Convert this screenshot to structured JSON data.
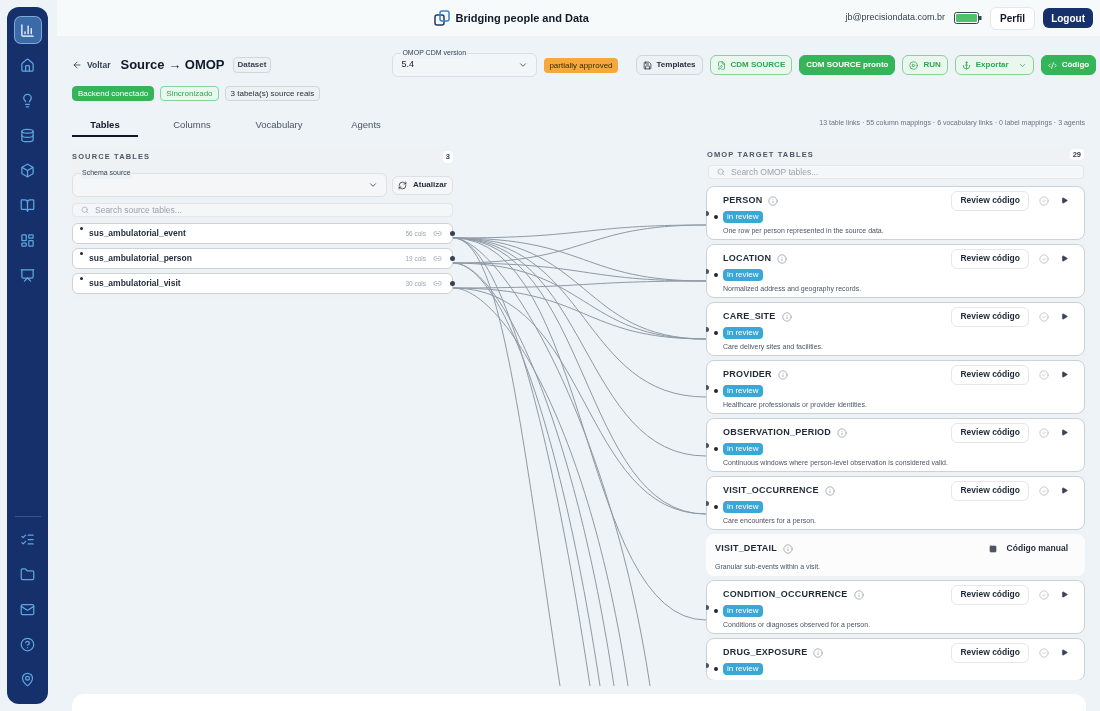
{
  "sidebar": {
    "items": [
      {
        "selected": true
      },
      {
        "selected": false
      },
      {
        "selected": false
      },
      {
        "selected": false
      },
      {
        "selected": false
      },
      {
        "selected": false
      },
      {
        "selected": false
      },
      {
        "selected": false
      }
    ],
    "bottom_items": [
      {
        "selected": false
      },
      {
        "selected": false
      },
      {
        "selected": false
      },
      {
        "selected": false
      },
      {
        "selected": false
      }
    ]
  },
  "header": {
    "brand": "Bridging people and Data",
    "email": "jb@precisiondata.com.br",
    "buttons": [
      "Perfil",
      "Logout"
    ]
  },
  "toolbar": {
    "back": "Voltar",
    "title": "Source → OMOP",
    "title_badge": "Dataset",
    "version": {
      "label": "OMOP CDM version",
      "value": "5.4"
    },
    "approval": "partially approved",
    "buttons": [
      {
        "kind": "neutral",
        "label": "Templates"
      },
      {
        "kind": "outline",
        "label": "CDM SOURCE"
      },
      {
        "kind": "solid",
        "label": "CDM SOURCE pronto"
      },
      {
        "kind": "outline",
        "label": "RUN"
      },
      {
        "kind": "dropdown",
        "label": "Exportar"
      },
      {
        "kind": "solid",
        "label": "Código"
      }
    ]
  },
  "status_badges": [
    {
      "kind": "solid",
      "label": "Backend conectado"
    },
    {
      "kind": "outline",
      "label": "Sincronizado"
    },
    {
      "kind": "neutral",
      "label": "3 tabela(s) source reais"
    }
  ],
  "tabs": [
    {
      "label": "Tables",
      "selected": true
    },
    {
      "label": "Columns",
      "selected": false
    },
    {
      "label": "Vocabulary",
      "selected": false
    },
    {
      "label": "Agents",
      "selected": false
    }
  ],
  "stats": "13 table links · 55 column mappings · 6 vocabulary links · 0 label mappings · 3 agents",
  "source_panel": {
    "title": "SOURCE TABLES",
    "count": "3",
    "schema_label": "Schema source",
    "refresh": "Atualizar",
    "search_placeholder": "Search source tables...",
    "tables": [
      {
        "name": "sus_ambulatorial_event",
        "cols": "56 cols"
      },
      {
        "name": "sus_ambulatorial_person",
        "cols": "19 cols"
      },
      {
        "name": "sus_ambulatorial_visit",
        "cols": "30 cols"
      }
    ]
  },
  "target_panel": {
    "title": "OMOP TARGET TABLES",
    "count": "29",
    "search_placeholder": "Search OMOP tables...",
    "tables": [
      {
        "kind": "review",
        "name": "PERSON",
        "status": "in review",
        "description": "One row per person represented in the source data.",
        "action": "Review código"
      },
      {
        "kind": "review",
        "name": "LOCATION",
        "status": "in review",
        "description": "Normalized address and geography records.",
        "action": "Review código"
      },
      {
        "kind": "review",
        "name": "CARE_SITE",
        "status": "in review",
        "description": "Care delivery sites and facilities.",
        "action": "Review código"
      },
      {
        "kind": "review",
        "name": "PROVIDER",
        "status": "in review",
        "description": "Healthcare professionals or provider identities.",
        "action": "Review código"
      },
      {
        "kind": "review",
        "name": "OBSERVATION_PERIOD",
        "status": "in review",
        "description": "Continuous windows where person-level observation is considered valid.",
        "action": "Review código"
      },
      {
        "kind": "review",
        "name": "VISIT_OCCURRENCE",
        "status": "in review",
        "description": "Care encounters for a person.",
        "action": "Review código"
      },
      {
        "kind": "manual",
        "name": "VISIT_DETAIL",
        "description": "Granular sub-events within a visit.",
        "action": "Código manual"
      },
      {
        "kind": "review",
        "name": "CONDITION_OCCURRENCE",
        "status": "in review",
        "description": "Conditions or diagnoses observed for a person.",
        "action": "Review código"
      },
      {
        "kind": "review",
        "name": "DRUG_EXPOSURE",
        "status": "in review",
        "action": "Review código"
      }
    ]
  }
}
